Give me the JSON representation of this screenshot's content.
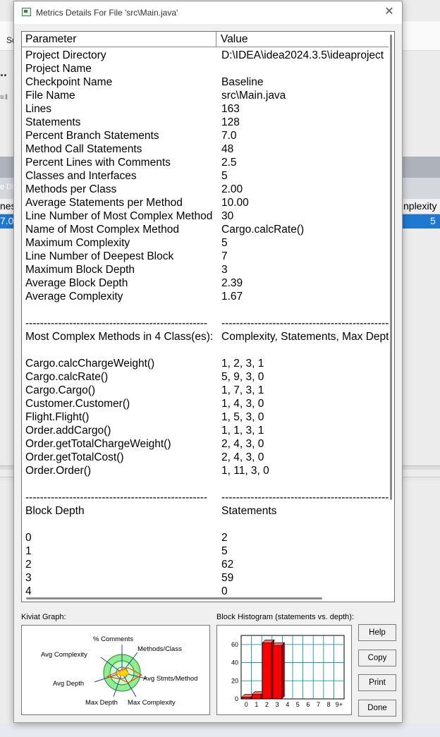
{
  "background": {
    "toolbar_label": "Sc",
    "ellipsis": "..",
    "left_row_label": "nes",
    "left_row_value": "7.0",
    "left_tab_label": "e Di",
    "right_header_label": "nplexity",
    "right_row_value": "5"
  },
  "dialog": {
    "title": "Metrics Details For File 'src\\Main.java'",
    "close_glyph": "✕"
  },
  "table": {
    "headers": {
      "parameter": "Parameter",
      "value": "Value"
    },
    "rows": [
      [
        "Project Directory",
        "D:\\IDEA\\idea2024.3.5\\ideaproject"
      ],
      [
        "Project Name",
        ""
      ],
      [
        "Checkpoint Name",
        "Baseline"
      ],
      [
        "File Name",
        "src\\Main.java"
      ],
      [
        "Lines",
        "163"
      ],
      [
        "Statements",
        "128"
      ],
      [
        "Percent Branch Statements",
        "7.0"
      ],
      [
        "Method Call Statements",
        "48"
      ],
      [
        "Percent Lines with Comments",
        "2.5"
      ],
      [
        "Classes and Interfaces",
        "5"
      ],
      [
        "Methods per Class",
        "2.00"
      ],
      [
        "Average Statements per Method",
        "10.00"
      ],
      [
        "Line Number of Most Complex Method",
        "30"
      ],
      [
        "Name of Most Complex Method",
        "Cargo.calcRate()"
      ],
      [
        "Maximum Complexity",
        "5"
      ],
      [
        "Line Number of Deepest Block",
        "7"
      ],
      [
        "Maximum Block Depth",
        "3"
      ],
      [
        "Average Block Depth",
        "2.39"
      ],
      [
        "Average Complexity",
        "1.67"
      ],
      [
        "",
        ""
      ],
      [
        "--------------------------------------------------",
        "------------------------------------------------------------"
      ],
      [
        "Most Complex Methods in 4 Class(es):",
        "Complexity, Statements, Max Depth"
      ],
      [
        "",
        ""
      ],
      [
        "Cargo.calcChargeWeight()",
        "1, 2, 3, 1"
      ],
      [
        "Cargo.calcRate()",
        "5, 9, 3, 0"
      ],
      [
        "Cargo.Cargo()",
        "1, 7, 3, 1"
      ],
      [
        "Customer.Customer()",
        "1, 4, 3, 0"
      ],
      [
        "Flight.Flight()",
        "1, 5, 3, 0"
      ],
      [
        "Order.addCargo()",
        "1, 1, 3, 1"
      ],
      [
        "Order.getTotalChargeWeight()",
        "2, 4, 3, 0"
      ],
      [
        "Order.getTotalCost()",
        "2, 4, 3, 0"
      ],
      [
        "Order.Order()",
        "1, 11, 3, 0"
      ],
      [
        "",
        ""
      ],
      [
        "--------------------------------------------------",
        "------------------------------------------------------------"
      ],
      [
        "Block Depth",
        "Statements"
      ],
      [
        "",
        ""
      ],
      [
        "0",
        "2"
      ],
      [
        "1",
        "5"
      ],
      [
        "2",
        "62"
      ],
      [
        "3",
        "59"
      ],
      [
        "4",
        "0"
      ]
    ]
  },
  "kiviat": {
    "label": "Kiviat Graph:",
    "axes": [
      "% Comments",
      "Methods/Class",
      "Avg Stmts/Method",
      "Max Complexity",
      "Max Depth",
      "Avg Depth",
      "Avg Complexity"
    ]
  },
  "histogram": {
    "label": "Block Histogram (statements vs. depth):",
    "y_ticks": [
      "60",
      "40",
      "20",
      "0"
    ],
    "x_ticks": [
      "0",
      "1",
      "2",
      "3",
      "4",
      "5",
      "6",
      "7",
      "8",
      "9+"
    ],
    "values": [
      2,
      5,
      62,
      59,
      0,
      0,
      0,
      0,
      0,
      0
    ],
    "ylim": [
      0,
      70
    ],
    "bar_color": "#ff0000"
  },
  "buttons": {
    "help": "Help",
    "copy": "Copy",
    "print": "Print",
    "done": "Done"
  }
}
